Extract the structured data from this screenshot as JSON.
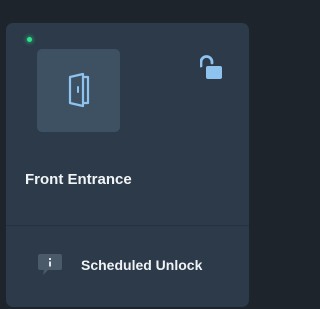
{
  "device": {
    "name": "Front Entrance",
    "status": "online",
    "lock_state": "unlocked",
    "device_icon": "door-icon",
    "lock_icon": "unlocked-padlock-icon"
  },
  "footer": {
    "label": "Scheduled Unlock",
    "icon": "info-message-icon"
  },
  "colors": {
    "page_background": "#1d242c",
    "card_background": "#2c3a49",
    "tile_background": "#3e5163",
    "accent": "#8ec3f0",
    "status_online": "#2ee58a",
    "text": "#f2f5f8"
  }
}
